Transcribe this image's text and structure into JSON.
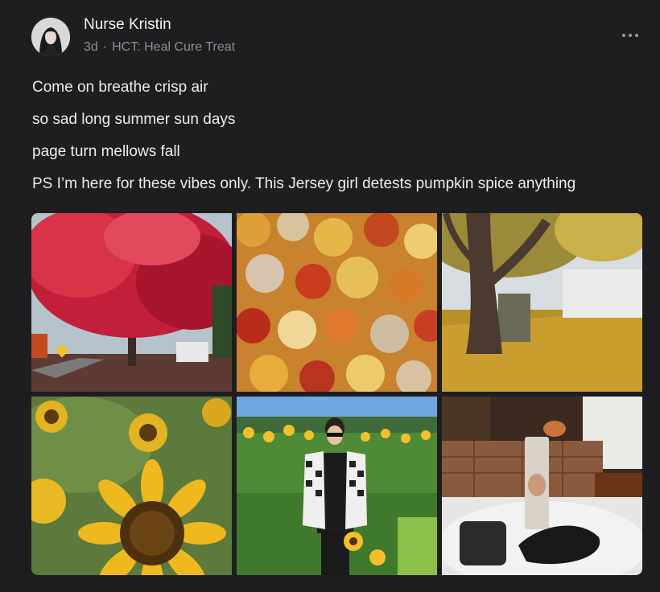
{
  "post": {
    "author": "Nurse Kristin",
    "age": "3d",
    "separator": "·",
    "community": "HCT: Heal Cure Treat",
    "lines": [
      "Come on breathe crisp air",
      "so sad long summer sun days",
      "page turn mellows fall",
      "PS I’m here for these vibes only. This Jersey girl detests pumpkin spice anything"
    ],
    "more_icon": "ellipsis-icon"
  },
  "colors": {
    "background": "#1e1e21",
    "text": "#ececee",
    "muted": "#8e8e93"
  }
}
